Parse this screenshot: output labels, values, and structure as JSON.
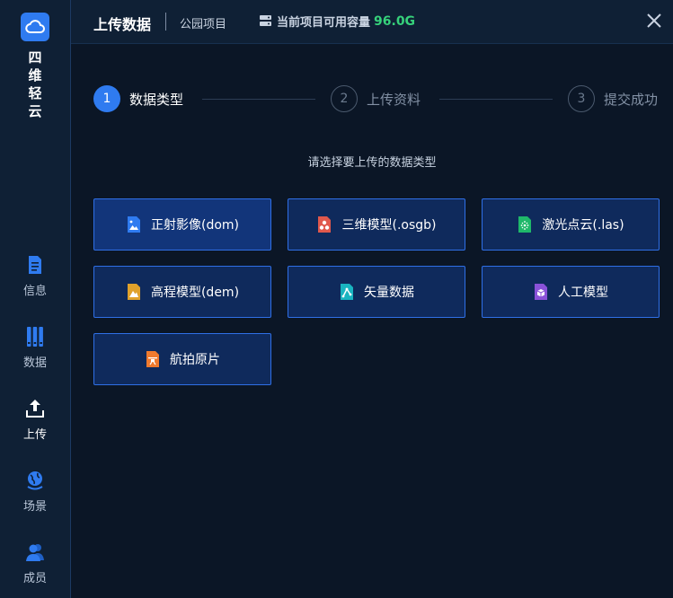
{
  "sidebar": {
    "brand": [
      "四",
      "维",
      "轻",
      "云"
    ],
    "items": [
      {
        "label": "信息",
        "icon": "document-icon"
      },
      {
        "label": "数据",
        "icon": "data-columns-icon"
      },
      {
        "label": "上传",
        "icon": "upload-icon"
      },
      {
        "label": "场景",
        "icon": "globe-icon"
      },
      {
        "label": "成员",
        "icon": "members-icon"
      }
    ]
  },
  "header": {
    "title": "上传数据",
    "project": "公园项目",
    "capacity_label": "当前项目可用容量",
    "capacity_value": "96.0G"
  },
  "steps": [
    {
      "num": "1",
      "label": "数据类型"
    },
    {
      "num": "2",
      "label": "上传资料"
    },
    {
      "num": "3",
      "label": "提交成功"
    }
  ],
  "subtitle": "请选择要上传的数据类型",
  "types": [
    {
      "label": "正射影像(dom)",
      "icon": "image-file-icon",
      "color": "#2f7bf0"
    },
    {
      "label": "三维模型(.osgb)",
      "icon": "3d-model-file-icon",
      "color": "#e0584c"
    },
    {
      "label": "激光点云(.las)",
      "icon": "point-cloud-file-icon",
      "color": "#1fb86a"
    },
    {
      "label": "高程模型(dem)",
      "icon": "elevation-file-icon",
      "color": "#e0a12b"
    },
    {
      "label": "矢量数据",
      "icon": "vector-file-icon",
      "color": "#19b4c0"
    },
    {
      "label": "人工模型",
      "icon": "manual-model-file-icon",
      "color": "#8a52d8"
    },
    {
      "label": "航拍原片",
      "icon": "aerial-photo-file-icon",
      "color": "#f07a2e"
    }
  ],
  "colors": {
    "accent": "#2f7bf0",
    "capacity": "#36d17b"
  }
}
